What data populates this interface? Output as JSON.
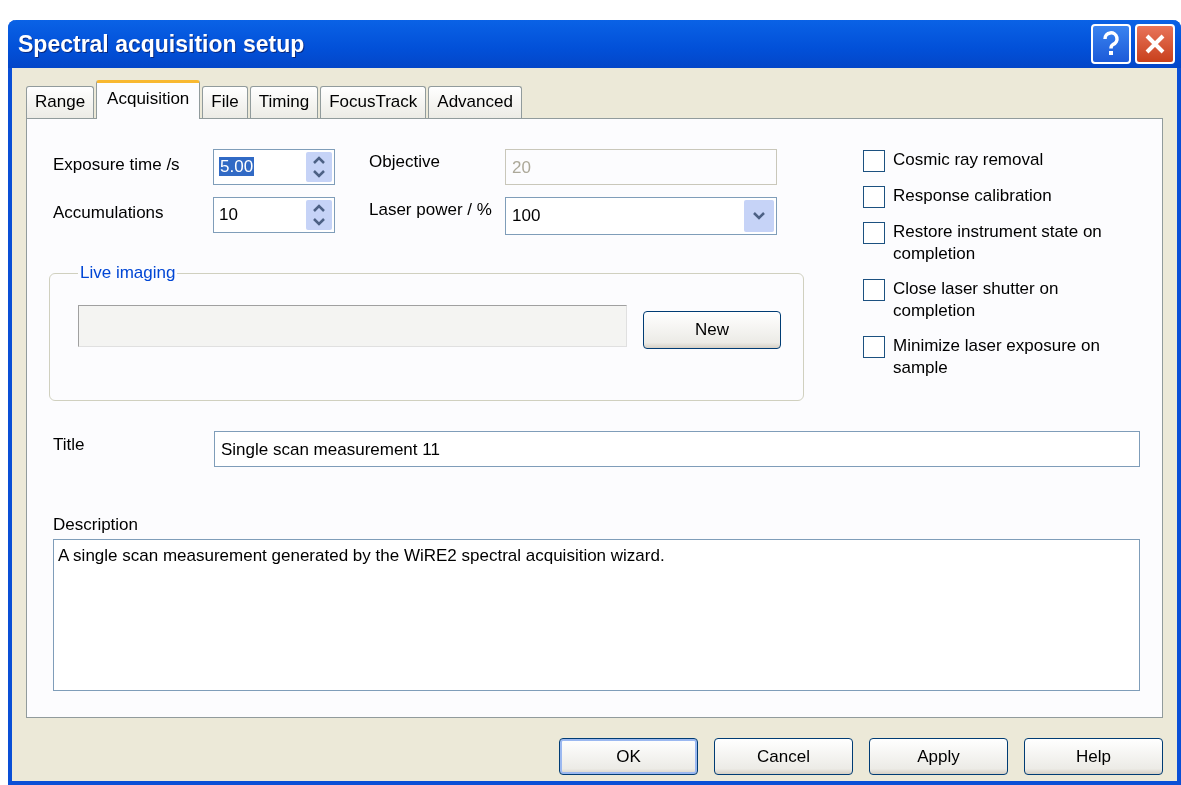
{
  "window": {
    "title": "Spectral acquisition setup"
  },
  "tabs": [
    {
      "label": "Range",
      "selected": false
    },
    {
      "label": "Acquisition",
      "selected": true
    },
    {
      "label": "File",
      "selected": false
    },
    {
      "label": "Timing",
      "selected": false
    },
    {
      "label": "FocusTrack",
      "selected": false
    },
    {
      "label": "Advanced",
      "selected": false
    }
  ],
  "fields": [
    {
      "kind": "spinner",
      "label": "Exposure time /s",
      "value": "5.00",
      "selected": true,
      "disabled": false
    },
    {
      "kind": "text",
      "label": "Objective",
      "value": "20",
      "selected": false,
      "disabled": true
    },
    {
      "kind": "spinner",
      "label": "Accumulations",
      "value": "10",
      "selected": false,
      "disabled": false
    },
    {
      "kind": "dropdown",
      "label": "Laser power / %",
      "value": "100",
      "selected": false,
      "disabled": false
    }
  ],
  "live_imaging": {
    "label": "Live imaging",
    "button": "New"
  },
  "options": [
    {
      "label": "Cosmic ray removal",
      "checked": false
    },
    {
      "label": "Response calibration",
      "checked": false
    },
    {
      "label": "Restore instrument state on completion",
      "checked": false
    },
    {
      "label": "Close laser shutter on completion",
      "checked": false
    },
    {
      "label": "Minimize laser exposure on sample",
      "checked": false
    }
  ],
  "title_field": {
    "label": "Title",
    "value": "Single scan measurement 11"
  },
  "description": {
    "label": "Description",
    "value": "A single scan measurement generated by the WiRE2 spectral acquisition wizard."
  },
  "buttons": [
    {
      "label": "OK",
      "default": true
    },
    {
      "label": "Cancel",
      "default": false
    },
    {
      "label": "Apply",
      "default": false
    },
    {
      "label": "Help",
      "default": false
    }
  ]
}
